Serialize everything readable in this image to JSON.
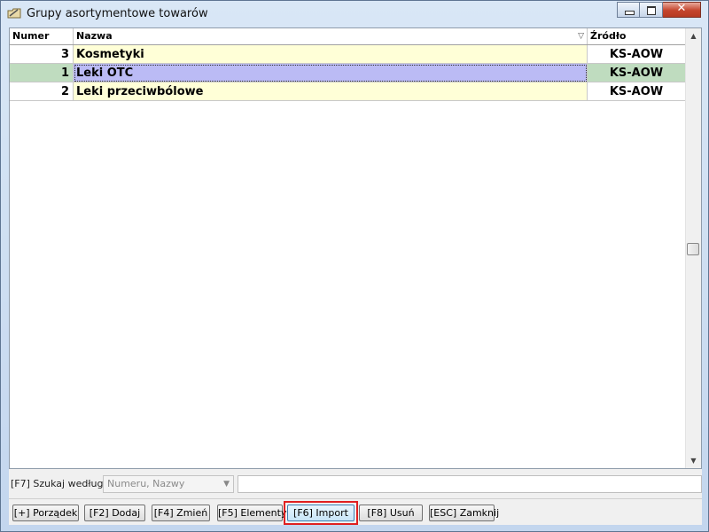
{
  "window": {
    "title": "Grupy asortymentowe towarów",
    "icon": "folder-edit-icon"
  },
  "grid": {
    "columns": [
      "Numer",
      "Nazwa",
      "Źródło"
    ],
    "sort_column": "Nazwa",
    "rows": [
      {
        "numer": "3",
        "nazwa": "Kosmetyki",
        "zrodlo": "KS-AOW"
      },
      {
        "numer": "1",
        "nazwa": "Leki OTC",
        "zrodlo": "KS-AOW",
        "selected": true
      },
      {
        "numer": "2",
        "nazwa": "Leki przeciwbólowe",
        "zrodlo": "KS-AOW"
      }
    ]
  },
  "search": {
    "label": "[F7] Szukaj według:",
    "selected_value": "Numeru, Nazwy",
    "query": ""
  },
  "buttons": {
    "order": "[+] Porządek",
    "add": "[F2] Dodaj",
    "edit": "[F4] Zmień",
    "elements": "[F5] Elementy",
    "import": "[F6] Import",
    "delete": "[F8] Usuń",
    "close": "[ESC] Zamknij"
  },
  "colors": {
    "name_cell_bg": "#ffffd7",
    "selected_row_bg": "#bfdcbf",
    "selected_name_bg": "#bbbbf5",
    "highlight_border": "#e02020"
  }
}
